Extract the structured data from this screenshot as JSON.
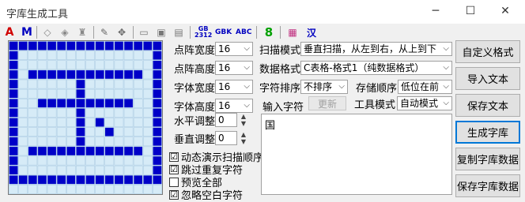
{
  "window": {
    "title": "字库生成工具",
    "min": "─",
    "max": "☐",
    "close": "✕"
  },
  "toolbar": {
    "a": "A",
    "m": "M",
    "pencil": "✎",
    "move": "✥",
    "open": "📂",
    "save": "💾",
    "gb2312_top": "GB",
    "gb2312_bot": "2312",
    "gbk": "GBK",
    "abc": "ABC",
    "eight": "8",
    "grid": "▦",
    "han": "汉"
  },
  "left": {
    "dot_width_label": "点阵宽度",
    "dot_width": "16",
    "dot_height_label": "点阵高度",
    "dot_height": "16",
    "font_width_label": "字体宽度",
    "font_width": "16",
    "font_height_label": "字体高度",
    "font_height": "16",
    "h_adjust_label": "水平调整",
    "h_adjust": "0",
    "v_adjust_label": "垂直调整",
    "v_adjust": "0",
    "checkboxes": [
      {
        "label": "动态演示扫描顺序",
        "checked": "☑"
      },
      {
        "label": "跳过重复字符",
        "checked": "☑"
      },
      {
        "label": "预览全部",
        "checked": ""
      },
      {
        "label": "忽略空白字符",
        "checked": "☑"
      }
    ]
  },
  "right": {
    "scan_mode_label": "扫描模式",
    "scan_mode": "垂直扫描，从左到右，从上到下",
    "data_format_label": "数据格式",
    "data_format": "C表格-格式1（纯数据格式）",
    "char_order_label": "字符排序",
    "char_order": "不排序",
    "storage_label": "存储顺序",
    "storage": "低位在前",
    "input_label": "输入字符",
    "update_btn": "更新",
    "tool_mode_label": "工具模式",
    "tool_mode": "自动模式",
    "text": "国"
  },
  "buttons": {
    "custom": "自定义格式",
    "import": "导入文本",
    "save_text": "保存文本",
    "gen": "生成字库",
    "copy": "复制字库数据",
    "save_data": "保存字库数据"
  },
  "bitmap": [
    "1111111111111111",
    "1000000000000001",
    "1000000000000001",
    "1011111111111101",
    "1000000100000001",
    "1000000100000001",
    "1001111111111001",
    "1000000100000001",
    "1000000101000001",
    "1000000100100001",
    "1000000100000001",
    "1011111111111101",
    "1000000000000001",
    "1000000000000001",
    "1111111111111111",
    "0000000000000000"
  ],
  "colors": {
    "on": "#0000c8",
    "grid_bg": "#d6ebf7",
    "focus": "#0078d7"
  }
}
